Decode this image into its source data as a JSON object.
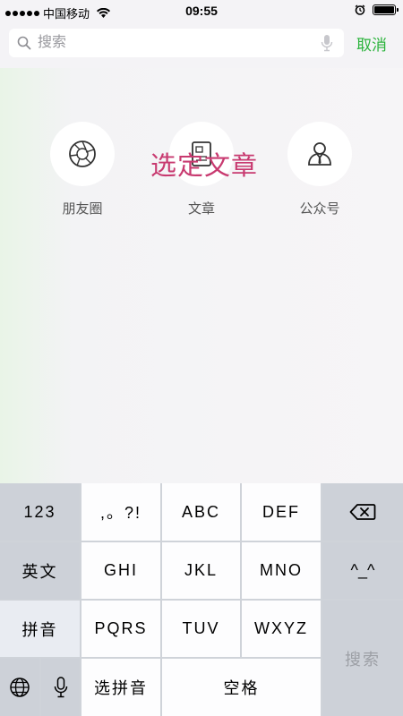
{
  "status_bar": {
    "carrier": "中国移动",
    "time": "09:55",
    "signal_dots": 5
  },
  "search": {
    "placeholder": "搜索",
    "value": "",
    "cancel_label": "取消"
  },
  "categories": [
    {
      "label": "朋友圈",
      "icon": "shutter-icon"
    },
    {
      "label": "文章",
      "icon": "article-icon"
    },
    {
      "label": "公众号",
      "icon": "person-icon"
    }
  ],
  "overlay_text": "选定文章",
  "keyboard": {
    "rows": [
      [
        "123",
        ",。?!",
        "ABC",
        "DEF",
        "⌫"
      ],
      [
        "英文",
        "GHI",
        "JKL",
        "MNO",
        "^^"
      ],
      [
        "拼音",
        "PQRS",
        "TUV",
        "WXYZ",
        "搜索"
      ],
      [
        "globe-icon",
        "mic-icon",
        "选拼音",
        "空格"
      ]
    ],
    "key_123": "123",
    "key_punct": ",。?!",
    "key_abc": "ABC",
    "key_def": "DEF",
    "key_english": "英文",
    "key_ghi": "GHI",
    "key_jkl": "JKL",
    "key_mno": "MNO",
    "key_emoticon": "^_^",
    "key_pinyin": "拼音",
    "key_pqrs": "PQRS",
    "key_tuv": "TUV",
    "key_wxyz": "WXYZ",
    "key_search": "搜索",
    "key_select_pinyin": "选拼音",
    "key_space": "空格"
  },
  "colors": {
    "accent": "#2ab33b",
    "overlay": "#c83a70",
    "keyboard_bg": "#cfd3d9"
  }
}
